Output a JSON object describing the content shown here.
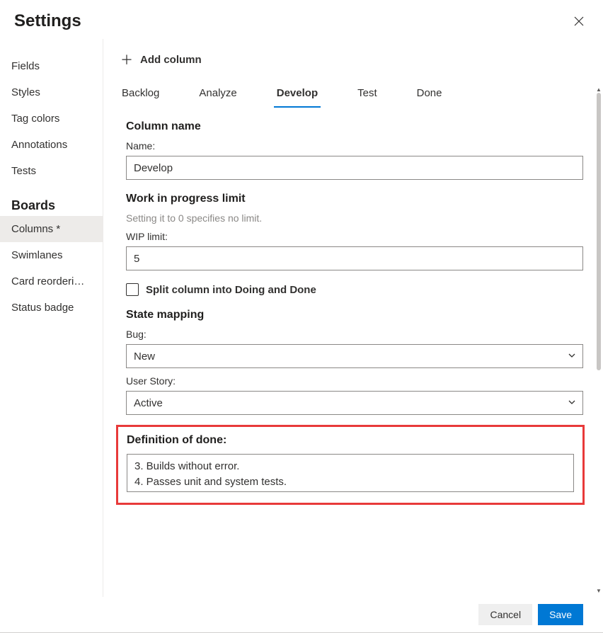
{
  "header": {
    "title": "Settings"
  },
  "sidebar": {
    "group1": [
      {
        "label": "Fields"
      },
      {
        "label": "Styles"
      },
      {
        "label": "Tag colors"
      },
      {
        "label": "Annotations"
      },
      {
        "label": "Tests"
      }
    ],
    "group2_title": "Boards",
    "group2": [
      {
        "label": "Columns *",
        "active": true
      },
      {
        "label": "Swimlanes"
      },
      {
        "label": "Card reorderi…"
      },
      {
        "label": "Status badge"
      }
    ]
  },
  "main": {
    "add_column_label": "Add column",
    "tabs": [
      {
        "label": "Backlog"
      },
      {
        "label": "Analyze"
      },
      {
        "label": "Develop",
        "active": true
      },
      {
        "label": "Test"
      },
      {
        "label": "Done"
      }
    ],
    "column_name": {
      "title": "Column name",
      "name_label": "Name:",
      "name_value": "Develop"
    },
    "wip": {
      "title": "Work in progress limit",
      "hint": "Setting it to 0 specifies no limit.",
      "label": "WIP limit:",
      "value": "5",
      "split_label": "Split column into Doing and Done",
      "split_checked": false
    },
    "state_mapping": {
      "title": "State mapping",
      "bug_label": "Bug:",
      "bug_value": "New",
      "user_story_label": "User Story:",
      "user_story_value": "Active"
    },
    "dod": {
      "title": "Definition of done:",
      "text": "3. Builds without error.\n4. Passes unit and system tests."
    }
  },
  "footer": {
    "cancel": "Cancel",
    "save": "Save"
  }
}
